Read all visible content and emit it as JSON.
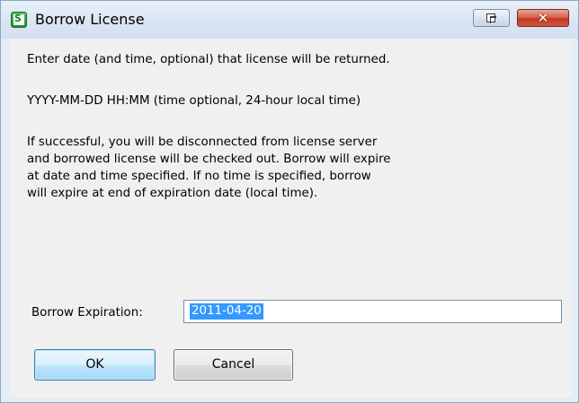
{
  "window": {
    "title": "Borrow License",
    "close_glyph": "✕"
  },
  "message": {
    "line1": "Enter date (and time, optional) that license will be returned.",
    "line2": "YYYY-MM-DD HH:MM (time optional, 24-hour local time)",
    "line3": [
      "If successful, you will be disconnected from license server",
      "and borrowed license will be checked out. Borrow will expire",
      "at date and time specified. If no time is specified, borrow",
      "will expire at end of expiration date (local time)."
    ]
  },
  "form": {
    "expiration_label": "Borrow Expiration:",
    "expiration_value": "2011-04-20"
  },
  "buttons": {
    "ok": "OK",
    "cancel": "Cancel"
  },
  "colors": {
    "title_gradient_top": "#e9f0f8",
    "selection": "#3399ff",
    "close_button": "#c13b23"
  },
  "icons": {
    "app": "app-icon",
    "restore": "restore-window-icon",
    "close": "close-icon"
  }
}
